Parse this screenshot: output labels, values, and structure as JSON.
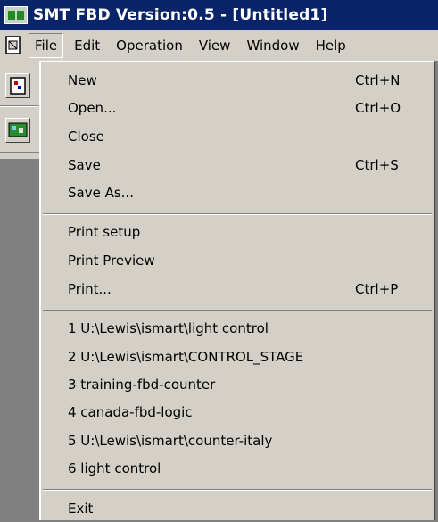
{
  "window": {
    "title": "SMT FBD Version:0.5 - [Untitled1]",
    "app_icon": "fbd-app-icon",
    "doc_icon": "document-icon"
  },
  "menubar": {
    "items": [
      "File",
      "Edit",
      "Operation",
      "View",
      "Window",
      "Help"
    ],
    "active": "File"
  },
  "toolbar": {
    "buttons": [
      "fbd-block-tool-icon",
      "fbd-link-tool-icon"
    ]
  },
  "file_menu": {
    "group1": [
      {
        "label": "New",
        "shortcut": "Ctrl+N"
      },
      {
        "label": "Open...",
        "shortcut": "Ctrl+O"
      },
      {
        "label": "Close",
        "shortcut": ""
      },
      {
        "label": "Save",
        "shortcut": "Ctrl+S"
      },
      {
        "label": "Save As...",
        "shortcut": ""
      }
    ],
    "group2": [
      {
        "label": "Print setup",
        "shortcut": ""
      },
      {
        "label": "Print Preview",
        "shortcut": ""
      },
      {
        "label": "Print...",
        "shortcut": "Ctrl+P"
      }
    ],
    "recent": [
      "1 U:\\Lewis\\ismart\\light control",
      "2 U:\\Lewis\\ismart\\CONTROL_STAGE",
      "3 training-fbd-counter",
      "4 canada-fbd-logic",
      "5 U:\\Lewis\\ismart\\counter-italy",
      "6 light control"
    ],
    "exit": "Exit"
  },
  "colors": {
    "titlebar": "#0a246a",
    "chrome": "#d4d0c8",
    "workspace": "#808080"
  }
}
